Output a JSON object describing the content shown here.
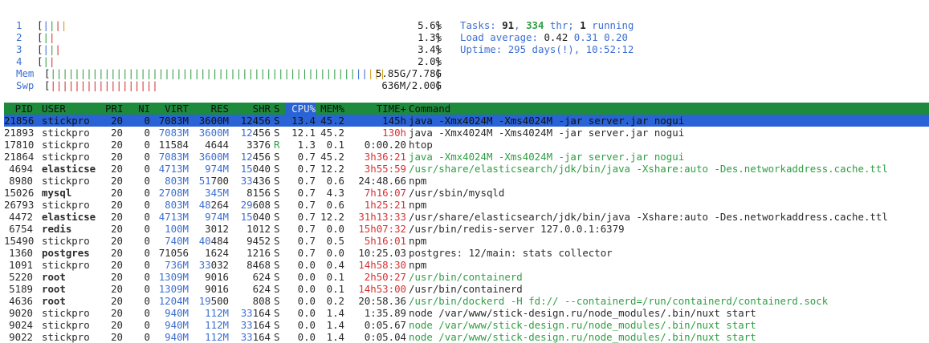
{
  "cpus": [
    {
      "label": "1",
      "bars": "||||",
      "colors": [
        "#3d6fd1",
        "#2f9e44",
        "#d33333",
        "#e08a1e"
      ],
      "value": "5.6%"
    },
    {
      "label": "2",
      "bars": "||",
      "colors": [
        "#2f9e44",
        "#d33333"
      ],
      "value": "1.3%"
    },
    {
      "label": "3",
      "bars": "|||",
      "colors": [
        "#3d6fd1",
        "#2f9e44",
        "#d33333"
      ],
      "value": "3.4%"
    },
    {
      "label": "4",
      "bars": "||",
      "colors": [
        "#2f9e44",
        "#d33333"
      ],
      "value": "2.0%"
    }
  ],
  "mem": {
    "label": "Mem",
    "bars_green": "|||||||||||||||||||||||||||||||||||||||||||||||||||",
    "bars_blue": "||",
    "bars_yellow": "|||",
    "value": "5.85G/7.78G"
  },
  "swp": {
    "label": "Swp",
    "bars_red": "||||||||||||||||||",
    "value": "636M/2.00G"
  },
  "info": {
    "tasks_label": "Tasks: ",
    "tasks": "91",
    "sep1": ", ",
    "threads": "334",
    "thr_label": " thr; ",
    "running": "1",
    "running_label": " running",
    "load_label": "Load average: ",
    "load1": "0.42",
    "load5": "0.31",
    "load15": "0.20",
    "uptime_label": "Uptime: ",
    "uptime": "295 days(!), 10:52:12"
  },
  "header": {
    "pid": "PID",
    "user": "USER",
    "pri": "PRI",
    "ni": "NI",
    "virt": "VIRT",
    "res": "RES",
    "shr": "SHR",
    "s": "S",
    "cpu": "CPU%",
    "mem": "MEM%",
    "time": "TIME+",
    "command": "Command"
  },
  "processes": [
    {
      "pid": "21856",
      "user": "stickpro",
      "pri": "20",
      "ni": "0",
      "virt": "7083M",
      "res": "3600M",
      "shr": "12456",
      "s": "S",
      "cpu": "13.4",
      "mem": "45.2",
      "time": "145h",
      "cmd": "java -Xmx4024M -Xms4024M -jar server.jar nogui",
      "selected": true
    },
    {
      "pid": "21893",
      "user": "stickpro",
      "pri": "20",
      "ni": "0",
      "virt": "7083M",
      "res": "3600M",
      "shr": "12456",
      "s": "S",
      "cpu": "12.1",
      "mem": "45.2",
      "time": "130h",
      "time_hl": true,
      "cmd": "java -Xmx4024M -Xms4024M -jar server.jar nogui"
    },
    {
      "pid": "17810",
      "user": "stickpro",
      "pri": "20",
      "ni": "0",
      "virt": "11584",
      "res": "4644",
      "shr": "3376",
      "s": "R",
      "cpu": "1.3",
      "mem": "0.1",
      "time": "0:00.20",
      "cmd": "htop"
    },
    {
      "pid": "21864",
      "user": "stickpro",
      "pri": "20",
      "ni": "0",
      "virt": "7083M",
      "res": "3600M",
      "shr": "12456",
      "s": "S",
      "cpu": "0.7",
      "mem": "45.2",
      "time": "3h36:21",
      "time_hl": true,
      "cmd": "java -Xmx4024M -Xms4024M -jar server.jar nogui",
      "cmd_green": true
    },
    {
      "pid": "4694",
      "user": "elasticse",
      "pri": "20",
      "ni": "0",
      "virt": "4713M",
      "res": "974M",
      "shr": "15040",
      "s": "S",
      "cpu": "0.7",
      "mem": "12.2",
      "time": "3h55:59",
      "time_hl": true,
      "cmd": "/usr/share/elasticsearch/jdk/bin/java -Xshare:auto -Des.networkaddress.cache.ttl",
      "cmd_green": true,
      "user_bold": true
    },
    {
      "pid": "8980",
      "user": "stickpro",
      "pri": "20",
      "ni": "0",
      "virt": "803M",
      "res": "51700",
      "shr": "33436",
      "s": "S",
      "cpu": "0.7",
      "mem": "0.6",
      "time": "24:48.66",
      "cmd": "npm"
    },
    {
      "pid": "15026",
      "user": "mysql",
      "pri": "20",
      "ni": "0",
      "virt": "2708M",
      "res": "345M",
      "shr": "8156",
      "s": "S",
      "cpu": "0.7",
      "mem": "4.3",
      "time": "7h16:07",
      "time_hl": true,
      "cmd": "/usr/sbin/mysqld",
      "user_bold": true
    },
    {
      "pid": "26793",
      "user": "stickpro",
      "pri": "20",
      "ni": "0",
      "virt": "803M",
      "res": "48264",
      "shr": "29608",
      "s": "S",
      "cpu": "0.7",
      "mem": "0.6",
      "time": "1h25:21",
      "time_hl": true,
      "cmd": "npm"
    },
    {
      "pid": "4472",
      "user": "elasticse",
      "pri": "20",
      "ni": "0",
      "virt": "4713M",
      "res": "974M",
      "shr": "15040",
      "s": "S",
      "cpu": "0.7",
      "mem": "12.2",
      "time": "31h13:33",
      "time_hl": true,
      "cmd": "/usr/share/elasticsearch/jdk/bin/java -Xshare:auto -Des.networkaddress.cache.ttl",
      "user_bold": true
    },
    {
      "pid": "6754",
      "user": "redis",
      "pri": "20",
      "ni": "0",
      "virt": "100M",
      "res": "3012",
      "shr": "1012",
      "s": "S",
      "cpu": "0.7",
      "mem": "0.0",
      "time": "15h07:32",
      "time_hl": true,
      "cmd": "/usr/bin/redis-server 127.0.0.1:6379",
      "user_bold": true
    },
    {
      "pid": "15490",
      "user": "stickpro",
      "pri": "20",
      "ni": "0",
      "virt": "740M",
      "res": "40484",
      "shr": "9452",
      "s": "S",
      "cpu": "0.7",
      "mem": "0.5",
      "time": "5h16:01",
      "time_hl": true,
      "cmd": "npm"
    },
    {
      "pid": "1360",
      "user": "postgres",
      "pri": "20",
      "ni": "0",
      "virt": "71056",
      "res": "1624",
      "shr": "1216",
      "s": "S",
      "cpu": "0.7",
      "mem": "0.0",
      "time": "10:25.03",
      "cmd": "postgres: 12/main: stats collector",
      "user_bold": true
    },
    {
      "pid": "1091",
      "user": "stickpro",
      "pri": "20",
      "ni": "0",
      "virt": "736M",
      "res": "33032",
      "shr": "8468",
      "s": "S",
      "cpu": "0.0",
      "mem": "0.4",
      "time": "14h58:30",
      "time_hl": true,
      "cmd": "npm"
    },
    {
      "pid": "5220",
      "user": "root",
      "pri": "20",
      "ni": "0",
      "virt": "1309M",
      "res": "9016",
      "shr": "624",
      "s": "S",
      "cpu": "0.0",
      "mem": "0.1",
      "time": "2h50:27",
      "time_hl": true,
      "cmd": "/usr/bin/containerd",
      "cmd_green": true,
      "user_bold": true
    },
    {
      "pid": "5189",
      "user": "root",
      "pri": "20",
      "ni": "0",
      "virt": "1309M",
      "res": "9016",
      "shr": "624",
      "s": "S",
      "cpu": "0.0",
      "mem": "0.1",
      "time": "14h53:00",
      "time_hl": true,
      "cmd": "/usr/bin/containerd",
      "user_bold": true
    },
    {
      "pid": "4636",
      "user": "root",
      "pri": "20",
      "ni": "0",
      "virt": "1204M",
      "res": "19500",
      "shr": "808",
      "s": "S",
      "cpu": "0.0",
      "mem": "0.2",
      "time": "20:58.36",
      "cmd": "/usr/bin/dockerd -H fd:// --containerd=/run/containerd/containerd.sock",
      "cmd_green": true,
      "user_bold": true
    },
    {
      "pid": "9020",
      "user": "stickpro",
      "pri": "20",
      "ni": "0",
      "virt": "940M",
      "res": "112M",
      "shr": "33164",
      "s": "S",
      "cpu": "0.0",
      "mem": "1.4",
      "time": "1:35.89",
      "cmd": "node /var/www/stick-design.ru/node_modules/.bin/nuxt start"
    },
    {
      "pid": "9024",
      "user": "stickpro",
      "pri": "20",
      "ni": "0",
      "virt": "940M",
      "res": "112M",
      "shr": "33164",
      "s": "S",
      "cpu": "0.0",
      "mem": "1.4",
      "time": "0:05.67",
      "cmd": "node /var/www/stick-design.ru/node_modules/.bin/nuxt start",
      "cmd_green": true
    },
    {
      "pid": "9022",
      "user": "stickpro",
      "pri": "20",
      "ni": "0",
      "virt": "940M",
      "res": "112M",
      "shr": "33164",
      "s": "S",
      "cpu": "0.0",
      "mem": "1.4",
      "time": "0:05.04",
      "cmd": "node /var/www/stick-design.ru/node_modules/.bin/nuxt start",
      "cmd_green": true
    }
  ]
}
